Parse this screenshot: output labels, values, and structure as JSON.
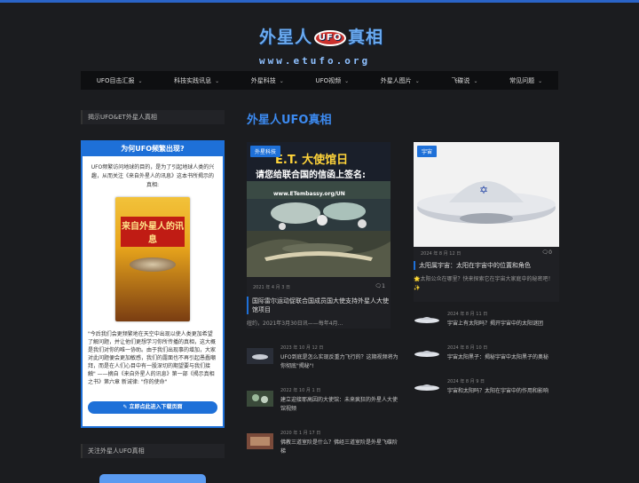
{
  "header": {
    "logo_title_left": "外星人",
    "logo_ufo": "UFO",
    "logo_title_right": "真相",
    "logo_url": "www.etufo.org"
  },
  "nav": [
    {
      "label": "UFO目击汇报"
    },
    {
      "label": "科技实践讯息"
    },
    {
      "label": "外星科技"
    },
    {
      "label": "UFO视频"
    },
    {
      "label": "外星人图片"
    },
    {
      "label": "飞碟说"
    },
    {
      "label": "常见问题"
    }
  ],
  "sidebar": {
    "head1": "揭示UFO&ET外星人真相",
    "promo_title": "为何UFO频繁出现?",
    "promo_text": "UFO频繁访问地球的目的，是为了引起地球人类的兴趣，从而关注《来自外星人的讯息》这本书所揭示的真相:",
    "book_title": "来自外星人的讯息",
    "promo_quote": "\"今后我们会更频繁地在天空中出现以使人类更加希望了解问题，并让他们更想学习你所传播的真相，这大概是我们对你的唯一协助。由于我们出现事的增加，大家对此问题便会更加敏感，我们的露面也不再引起愚蠢嘲拜，而是在人们心目中有一股深切的期望要与我们接触\" ——摘自《来自外星人的讯息》第一部《揭示真相之书》第六章 新诫律: \"你的使命\"",
    "promo_btn": "✎ 立即点此进入下载页面",
    "head2": "关注外星人UFO真相"
  },
  "main": {
    "section_title": "外星人UFO真相",
    "featured_left": {
      "badge": "外星科技",
      "image_text": "E.T. 大使馆日",
      "image_sub": "请您给联合国的信函上签名:",
      "image_url": "www.ETembassy.org/UN",
      "date": "2021 年 4 月 3 日",
      "comments": "1",
      "title": "国际雷尔运动促联合国成员国大使支持外星人大使馆项目",
      "excerpt": "纽约，2021年3月30日讯——每年4月..."
    },
    "featured_right": {
      "badge": "宇宙",
      "date": "2024 年 8 月 12 日",
      "comments": "0",
      "title": "太阳属宇宙：太阳在宇宙中的位置和角色",
      "excerpt": "🌟太阳公众在哪里？快来探索它在宇宙大家庭中的秘密吧！✨"
    },
    "mini_left": [
      {
        "date": "2023 年 10 月 12 日",
        "title": "UFO到底是怎么实现反重力飞行的？这期视频将为你彻底\"揭秘\"!"
      },
      {
        "date": "2022 年 10 月 1 日",
        "title": "建立迎接耶高因的大使馆：未来疯狂的外星人大使馆视频"
      },
      {
        "date": "2020 年 1 月 17 日",
        "title": "佛教三道室阶是什么？佛经三道室阶是外星飞碟阶梯"
      }
    ],
    "mini_right": [
      {
        "date": "2024 年 8 月 11 日",
        "title": "宇宙上有太阳吗？揭开宇宙中的太阳谜团"
      },
      {
        "date": "2024 年 8 月 10 日",
        "title": "宇宙太阳黑子：揭秘宇宙中太阳黑子的奥秘"
      },
      {
        "date": "2024 年 8 月 9 日",
        "title": "宇宙和太阳吗？太阳在宇宙中的作用和影响"
      }
    ]
  }
}
